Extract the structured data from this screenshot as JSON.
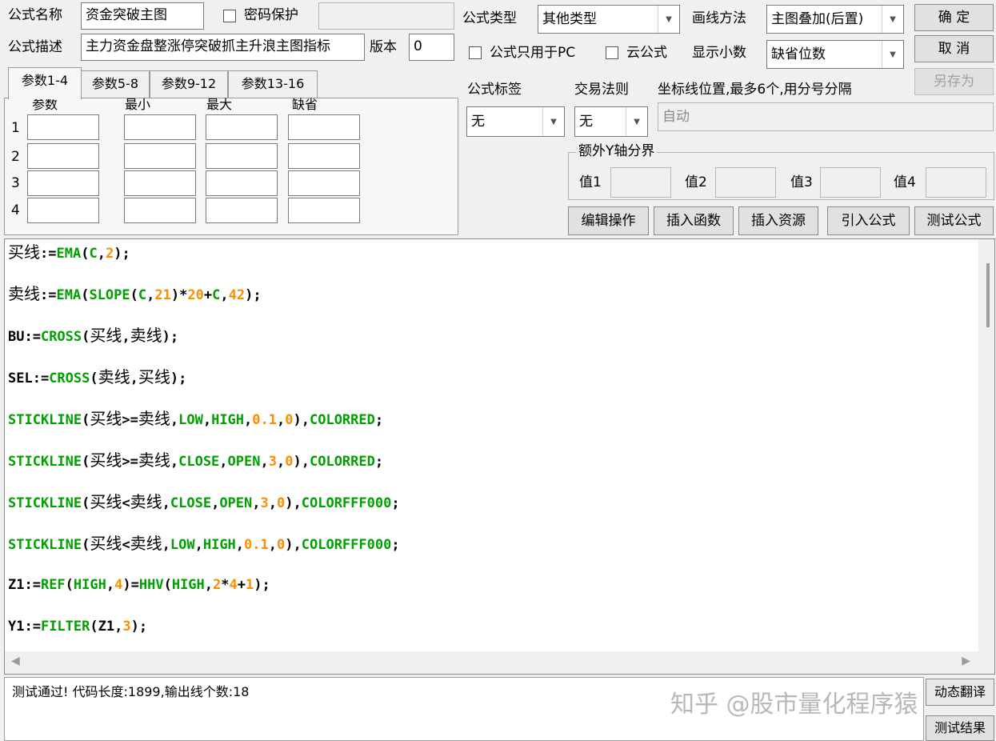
{
  "header": {
    "name_label": "公式名称",
    "name_value": "资金突破主图",
    "password_label": "密码保护",
    "desc_label": "公式描述",
    "desc_value": "主力资金盘整涨停突破抓主升浪主图指标",
    "version_label": "版本",
    "version_value": "0"
  },
  "settings": {
    "type_label": "公式类型",
    "type_value": "其他类型",
    "draw_label": "画线方法",
    "draw_value": "主图叠加(后置)",
    "pc_only_label": "公式只用于PC",
    "cloud_label": "云公式",
    "decimals_label": "显示小数",
    "decimals_value": "缺省位数",
    "tag_label": "公式标签",
    "tag_value": "无",
    "rule_label": "交易法则",
    "rule_value": "无",
    "axis_label": "坐标线位置,最多6个,用分号分隔",
    "axis_value": "自动",
    "yaxis_group": "额外Y轴分界",
    "y1": "值1",
    "y2": "值2",
    "y3": "值3",
    "y4": "值4"
  },
  "buttons": {
    "ok": "确 定",
    "cancel": "取 消",
    "save_as": "另存为",
    "edit": "编辑操作",
    "insert_fn": "插入函数",
    "insert_res": "插入资源",
    "import": "引入公式",
    "test": "测试公式",
    "translate": "动态翻译",
    "result": "测试结果"
  },
  "tabs": [
    "参数1-4",
    "参数5-8",
    "参数9-12",
    "参数13-16"
  ],
  "params": {
    "headers": [
      "参数",
      "最小",
      "最大",
      "缺省"
    ],
    "rows": [
      "1",
      "2",
      "3",
      "4"
    ]
  },
  "code_lines": [
    [
      [
        "cn",
        "买线"
      ],
      [
        "d",
        ":="
      ],
      [
        "f",
        "EMA"
      ],
      [
        "d",
        "("
      ],
      [
        "f",
        "C"
      ],
      [
        "d",
        ","
      ],
      [
        "n",
        "2"
      ],
      [
        "d",
        ");"
      ]
    ],
    [
      [
        "cn",
        "卖线"
      ],
      [
        "d",
        ":="
      ],
      [
        "f",
        "EMA"
      ],
      [
        "d",
        "("
      ],
      [
        "f",
        "SLOPE"
      ],
      [
        "d",
        "("
      ],
      [
        "f",
        "C"
      ],
      [
        "d",
        ","
      ],
      [
        "n",
        "21"
      ],
      [
        "d",
        ")*"
      ],
      [
        "n",
        "20"
      ],
      [
        "d",
        "+"
      ],
      [
        "f",
        "C"
      ],
      [
        "d",
        ","
      ],
      [
        "n",
        "42"
      ],
      [
        "d",
        ");"
      ]
    ],
    [
      [
        "d",
        "BU:="
      ],
      [
        "f",
        "CROSS"
      ],
      [
        "d",
        "("
      ],
      [
        "cn",
        "买线"
      ],
      [
        "d",
        ","
      ],
      [
        "cn",
        "卖线"
      ],
      [
        "d",
        ");"
      ]
    ],
    [
      [
        "d",
        "SEL:="
      ],
      [
        "f",
        "CROSS"
      ],
      [
        "d",
        "("
      ],
      [
        "cn",
        "卖线"
      ],
      [
        "d",
        ","
      ],
      [
        "cn",
        "买线"
      ],
      [
        "d",
        ");"
      ]
    ],
    [
      [
        "f",
        "STICKLINE"
      ],
      [
        "d",
        "("
      ],
      [
        "cn",
        "买线"
      ],
      [
        "d",
        ">="
      ],
      [
        "cn",
        "卖线"
      ],
      [
        "d",
        ","
      ],
      [
        "f",
        "LOW"
      ],
      [
        "d",
        ","
      ],
      [
        "f",
        "HIGH"
      ],
      [
        "d",
        ","
      ],
      [
        "n",
        "0.1"
      ],
      [
        "d",
        ","
      ],
      [
        "n",
        "0"
      ],
      [
        "d",
        "),"
      ],
      [
        "f",
        "COLORRED"
      ],
      [
        "d",
        ";"
      ]
    ],
    [
      [
        "f",
        "STICKLINE"
      ],
      [
        "d",
        "("
      ],
      [
        "cn",
        "买线"
      ],
      [
        "d",
        ">="
      ],
      [
        "cn",
        "卖线"
      ],
      [
        "d",
        ","
      ],
      [
        "f",
        "CLOSE"
      ],
      [
        "d",
        ","
      ],
      [
        "f",
        "OPEN"
      ],
      [
        "d",
        ","
      ],
      [
        "n",
        "3"
      ],
      [
        "d",
        ","
      ],
      [
        "n",
        "0"
      ],
      [
        "d",
        "),"
      ],
      [
        "f",
        "COLORRED"
      ],
      [
        "d",
        ";"
      ]
    ],
    [
      [
        "f",
        "STICKLINE"
      ],
      [
        "d",
        "("
      ],
      [
        "cn",
        "买线"
      ],
      [
        "d",
        "<"
      ],
      [
        "cn",
        "卖线"
      ],
      [
        "d",
        ","
      ],
      [
        "f",
        "CLOSE"
      ],
      [
        "d",
        ","
      ],
      [
        "f",
        "OPEN"
      ],
      [
        "d",
        ","
      ],
      [
        "n",
        "3"
      ],
      [
        "d",
        ","
      ],
      [
        "n",
        "0"
      ],
      [
        "d",
        "),"
      ],
      [
        "f",
        "COLORFFF000"
      ],
      [
        "d",
        ";"
      ]
    ],
    [
      [
        "f",
        "STICKLINE"
      ],
      [
        "d",
        "("
      ],
      [
        "cn",
        "买线"
      ],
      [
        "d",
        "<"
      ],
      [
        "cn",
        "卖线"
      ],
      [
        "d",
        ","
      ],
      [
        "f",
        "LOW"
      ],
      [
        "d",
        ","
      ],
      [
        "f",
        "HIGH"
      ],
      [
        "d",
        ","
      ],
      [
        "n",
        "0.1"
      ],
      [
        "d",
        ","
      ],
      [
        "n",
        "0"
      ],
      [
        "d",
        "),"
      ],
      [
        "f",
        "COLORFFF000"
      ],
      [
        "d",
        ";"
      ]
    ],
    [
      [
        "d",
        "Z1:="
      ],
      [
        "f",
        "REF"
      ],
      [
        "d",
        "("
      ],
      [
        "f",
        "HIGH"
      ],
      [
        "d",
        ","
      ],
      [
        "n",
        "4"
      ],
      [
        "d",
        ")="
      ],
      [
        "f",
        "HHV"
      ],
      [
        "d",
        "("
      ],
      [
        "f",
        "HIGH"
      ],
      [
        "d",
        ","
      ],
      [
        "n",
        "2"
      ],
      [
        "d",
        "*"
      ],
      [
        "n",
        "4"
      ],
      [
        "d",
        "+"
      ],
      [
        "n",
        "1"
      ],
      [
        "d",
        ");"
      ]
    ],
    [
      [
        "d",
        "Y1:="
      ],
      [
        "f",
        "FILTER"
      ],
      [
        "d",
        "(Z1,"
      ],
      [
        "n",
        "3"
      ],
      [
        "d",
        ");"
      ]
    ]
  ],
  "status": {
    "message": "测试通过! 代码长度:1899,输出线个数:18"
  },
  "watermark": "知乎 @股市量化程序猿",
  "colors": {
    "function": "#00a000",
    "number": "#ff8c00",
    "default": "#000000"
  },
  "icons": {
    "dropdown": "chevron-down-icon",
    "scroll_left": "scroll-left-icon",
    "scroll_right": "scroll-right-icon"
  }
}
